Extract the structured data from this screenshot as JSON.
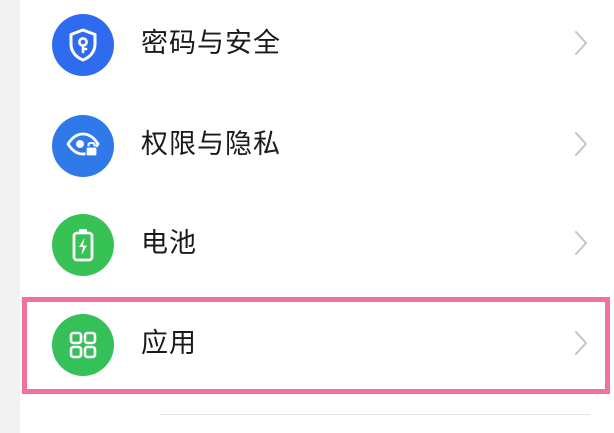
{
  "settings_list": {
    "items": [
      {
        "label": "密码与安全",
        "icon": "shield-lock-icon",
        "icon_color": "#2f6bef"
      },
      {
        "label": "权限与隐私",
        "icon": "eye-lock-icon",
        "icon_color": "#2f7ae8"
      },
      {
        "label": "电池",
        "icon": "battery-charging-icon",
        "icon_color": "#36c254"
      },
      {
        "label": "应用",
        "icon": "apps-grid-icon",
        "icon_color": "#35c05a"
      }
    ],
    "highlight_color": "#f0729a"
  }
}
